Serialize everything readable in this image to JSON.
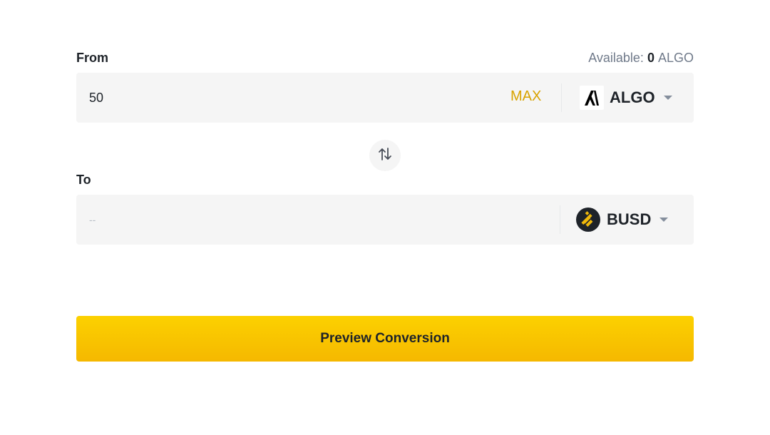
{
  "from": {
    "label": "From",
    "available_prefix": "Available: ",
    "available_amount": "0",
    "available_unit": "ALGO",
    "amount_value": "50",
    "max_label": "MAX",
    "coin": "ALGO",
    "coin_icon": "algorand-logo-icon"
  },
  "to": {
    "label": "To",
    "amount_placeholder": "--",
    "coin": "BUSD",
    "coin_icon": "busd-logo-icon"
  },
  "swap_icon": "swap-arrows-icon",
  "preview_button": "Preview Conversion",
  "colors": {
    "accent": "#fcd535",
    "max_text": "#d8a300",
    "field_bg": "#f5f5f5",
    "muted_text": "#707a8a"
  }
}
